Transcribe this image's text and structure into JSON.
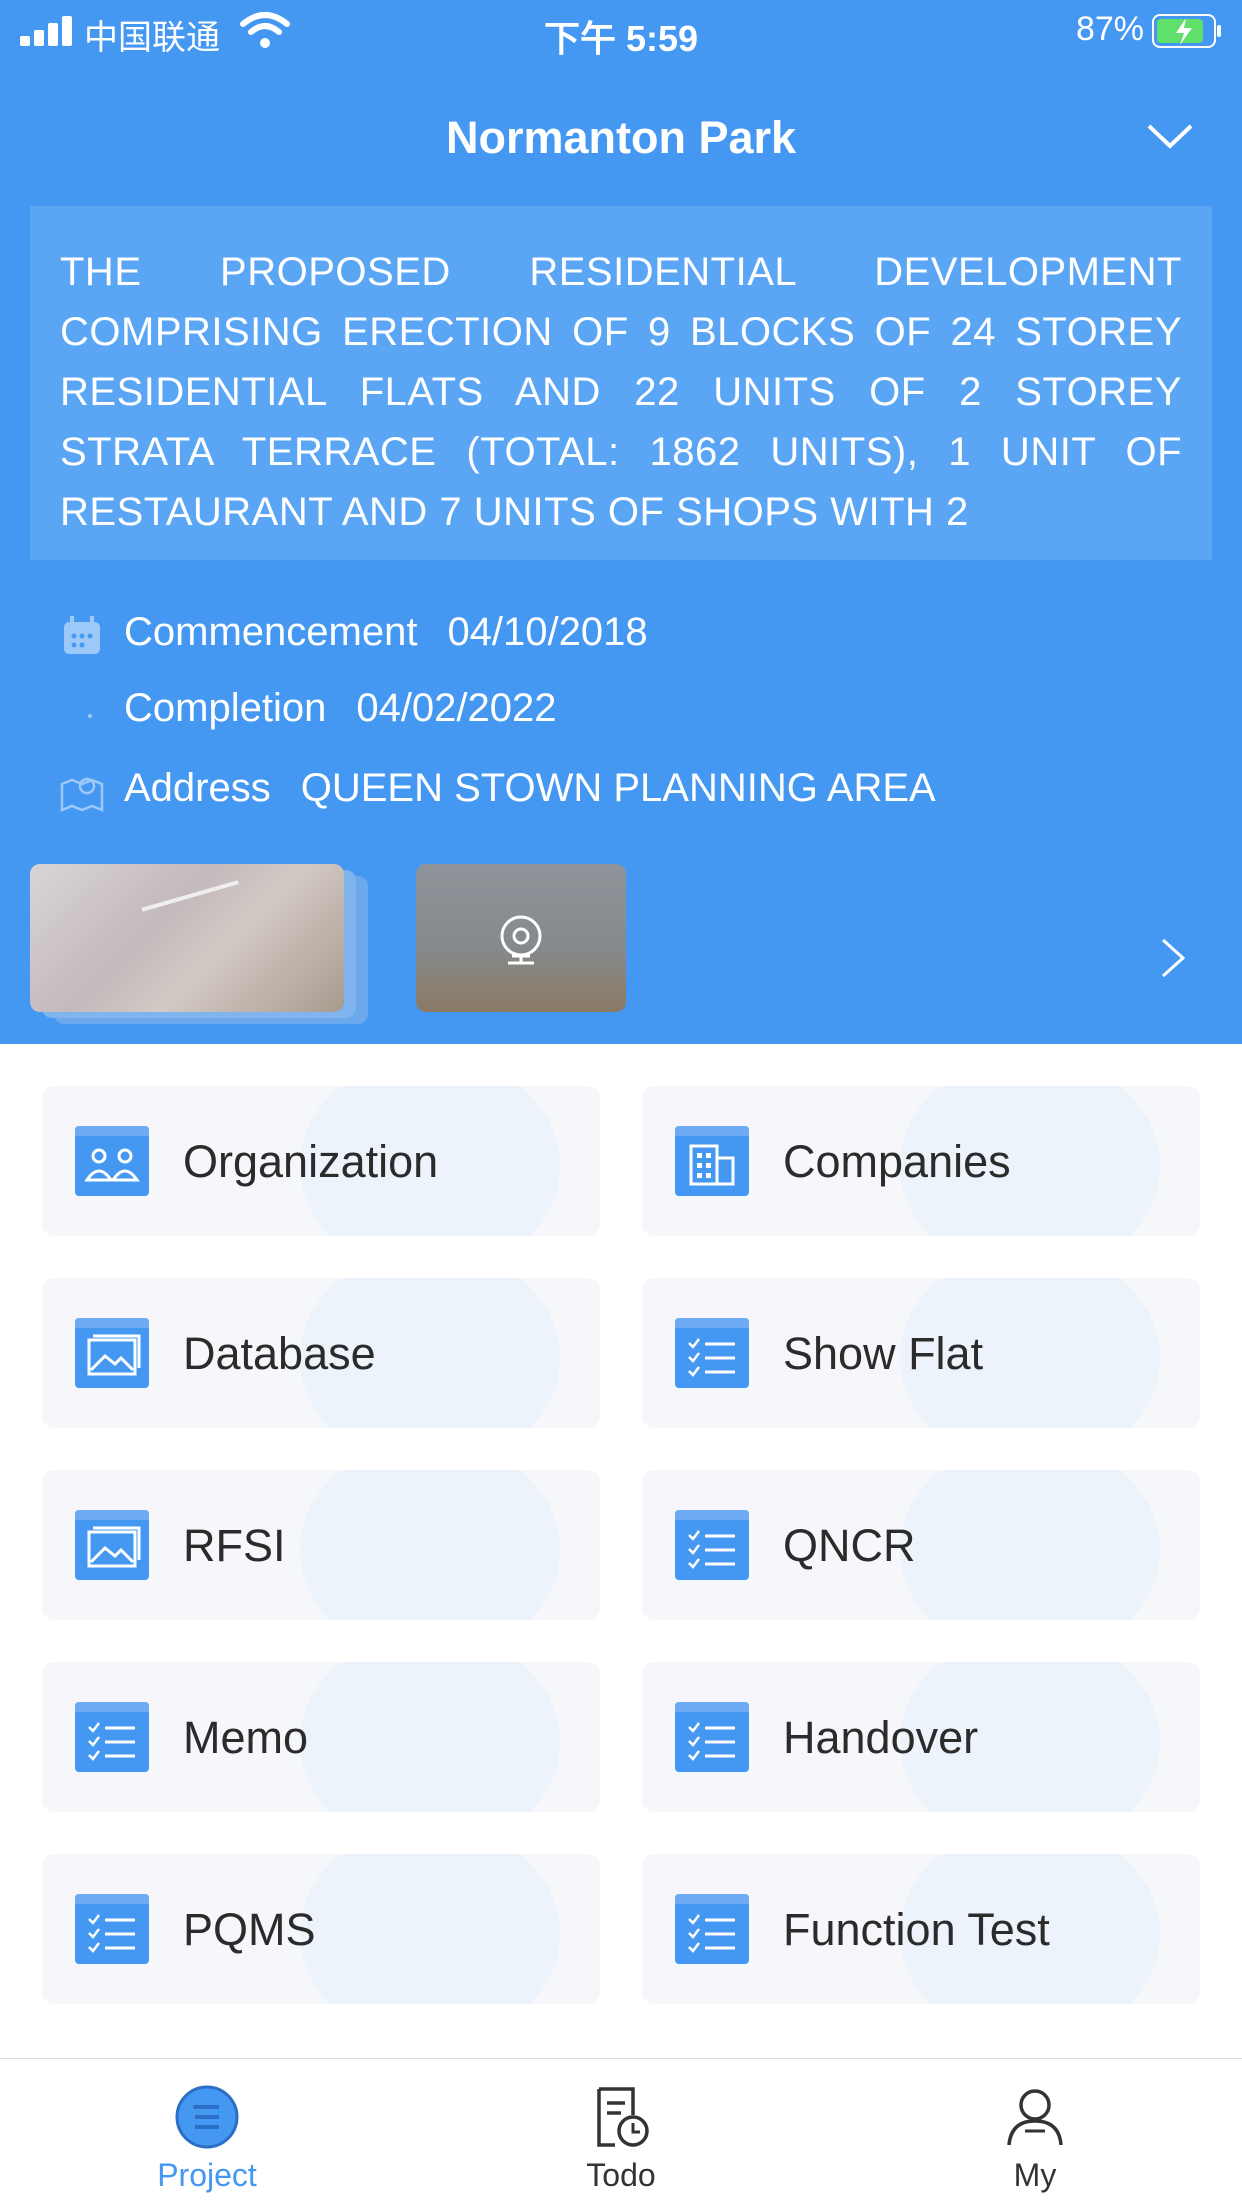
{
  "status_bar": {
    "carrier": "中国联通",
    "time": "下午 5:59",
    "battery": "87%"
  },
  "header": {
    "title": "Normanton Park"
  },
  "project": {
    "description": "THE PROPOSED RESIDENTIAL DEVELOPMENT COMPRISING ERECTION OF 9 BLOCKS OF 24 STOREY RESIDENTIAL FLATS AND 22 UNITS OF 2 STOREY STRATA TERRACE (TOTAL: 1862 UNITS), 1 UNIT OF RESTAURANT AND 7 UNITS OF SHOPS WITH 2",
    "commencement_label": "Commencement",
    "commencement_value": "04/10/2018",
    "completion_label": "Completion",
    "completion_value": "04/02/2022",
    "address_label": "Address",
    "address_value": "QUEEN STOWN PLANNING AREA"
  },
  "modules": [
    {
      "label": "Organization",
      "icon": "organization-icon"
    },
    {
      "label": "Companies",
      "icon": "building-icon"
    },
    {
      "label": "Database",
      "icon": "image-gallery-icon"
    },
    {
      "label": "Show Flat",
      "icon": "checklist-icon"
    },
    {
      "label": "RFSI",
      "icon": "image-gallery-icon"
    },
    {
      "label": "QNCR",
      "icon": "checklist-icon"
    },
    {
      "label": "Memo",
      "icon": "checklist-icon"
    },
    {
      "label": "Handover",
      "icon": "checklist-icon"
    },
    {
      "label": "PQMS",
      "icon": "checklist-icon"
    },
    {
      "label": "Function Test",
      "icon": "checklist-icon"
    }
  ],
  "tabs": [
    {
      "label": "Project",
      "active": true
    },
    {
      "label": "Todo",
      "active": false
    },
    {
      "label": "My",
      "active": false
    }
  ],
  "colors": {
    "accent": "#4598f2",
    "card_bg": "#f5f7fa"
  }
}
